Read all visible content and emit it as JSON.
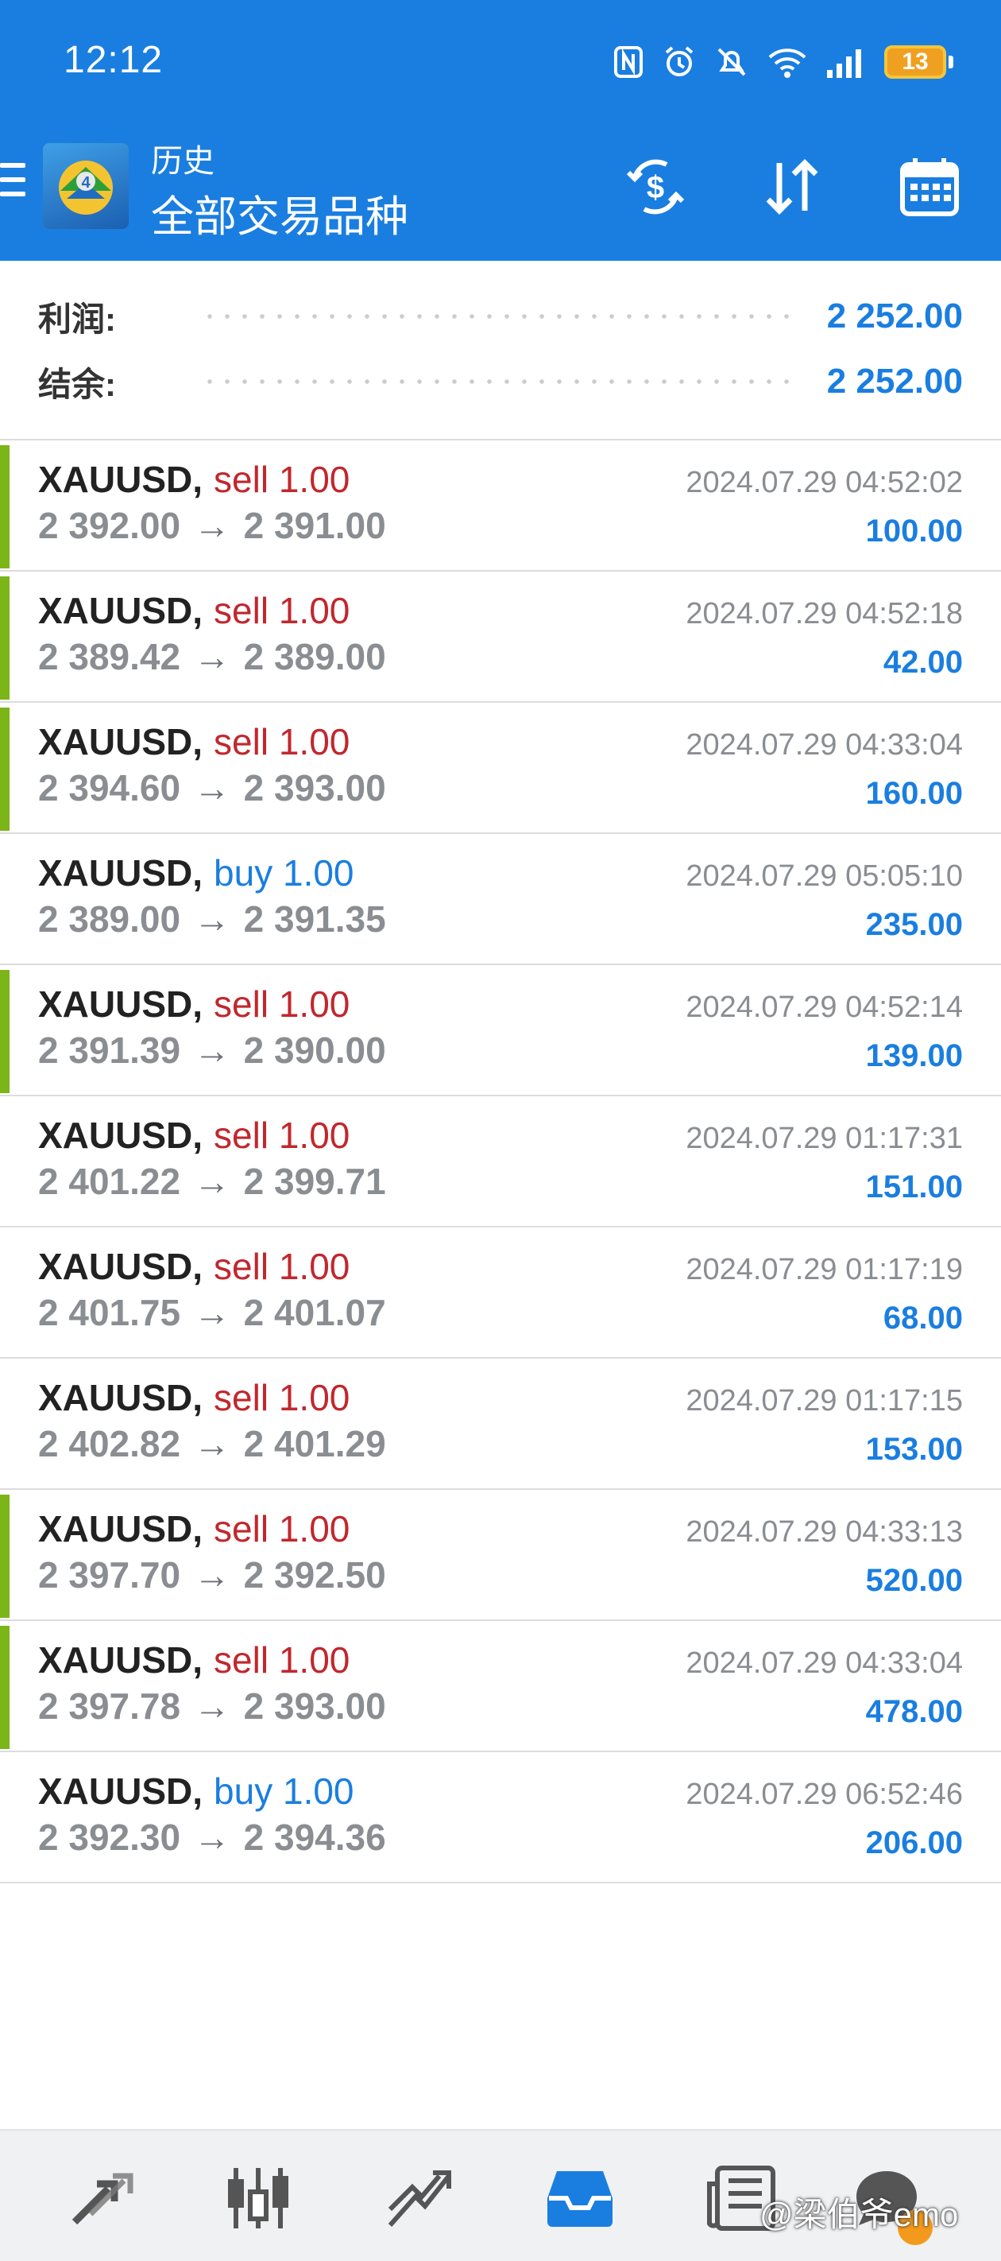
{
  "status_bar": {
    "time": "12:12",
    "battery": "13"
  },
  "header": {
    "subtitle": "历史",
    "title": "全部交易品种"
  },
  "summary": {
    "profit_label": "利润:",
    "profit_value": "2 252.00",
    "balance_label": "结余:",
    "balance_value": "2 252.00"
  },
  "trades": [
    {
      "symbol": "XAUUSD",
      "side": "sell",
      "volume": "1.00",
      "open_price": "2 392.00",
      "close_price": "2 391.00",
      "time": "2024.07.29 04:52:02",
      "profit": "100.00",
      "accent": true
    },
    {
      "symbol": "XAUUSD",
      "side": "sell",
      "volume": "1.00",
      "open_price": "2 389.42",
      "close_price": "2 389.00",
      "time": "2024.07.29 04:52:18",
      "profit": "42.00",
      "accent": true
    },
    {
      "symbol": "XAUUSD",
      "side": "sell",
      "volume": "1.00",
      "open_price": "2 394.60",
      "close_price": "2 393.00",
      "time": "2024.07.29 04:33:04",
      "profit": "160.00",
      "accent": true
    },
    {
      "symbol": "XAUUSD",
      "side": "buy",
      "volume": "1.00",
      "open_price": "2 389.00",
      "close_price": "2 391.35",
      "time": "2024.07.29 05:05:10",
      "profit": "235.00",
      "accent": false
    },
    {
      "symbol": "XAUUSD",
      "side": "sell",
      "volume": "1.00",
      "open_price": "2 391.39",
      "close_price": "2 390.00",
      "time": "2024.07.29 04:52:14",
      "profit": "139.00",
      "accent": true
    },
    {
      "symbol": "XAUUSD",
      "side": "sell",
      "volume": "1.00",
      "open_price": "2 401.22",
      "close_price": "2 399.71",
      "time": "2024.07.29 01:17:31",
      "profit": "151.00",
      "accent": false
    },
    {
      "symbol": "XAUUSD",
      "side": "sell",
      "volume": "1.00",
      "open_price": "2 401.75",
      "close_price": "2 401.07",
      "time": "2024.07.29 01:17:19",
      "profit": "68.00",
      "accent": false
    },
    {
      "symbol": "XAUUSD",
      "side": "sell",
      "volume": "1.00",
      "open_price": "2 402.82",
      "close_price": "2 401.29",
      "time": "2024.07.29 01:17:15",
      "profit": "153.00",
      "accent": false
    },
    {
      "symbol": "XAUUSD",
      "side": "sell",
      "volume": "1.00",
      "open_price": "2 397.70",
      "close_price": "2 392.50",
      "time": "2024.07.29 04:33:13",
      "profit": "520.00",
      "accent": true
    },
    {
      "symbol": "XAUUSD",
      "side": "sell",
      "volume": "1.00",
      "open_price": "2 397.78",
      "close_price": "2 393.00",
      "time": "2024.07.29 04:33:04",
      "profit": "478.00",
      "accent": true
    },
    {
      "symbol": "XAUUSD",
      "side": "buy",
      "volume": "1.00",
      "open_price": "2 392.30",
      "close_price": "2 394.36",
      "time": "2024.07.29 06:52:46",
      "profit": "206.00",
      "accent": false
    }
  ],
  "bottom_nav": [
    {
      "icon": "quotes-arrows-icon",
      "active": false
    },
    {
      "icon": "candlestick-chart-icon",
      "active": false
    },
    {
      "icon": "trade-chart-icon",
      "active": false
    },
    {
      "icon": "history-inbox-icon",
      "active": true
    },
    {
      "icon": "news-icon",
      "active": false
    },
    {
      "icon": "messages-icon",
      "active": false
    }
  ],
  "watermark": "@梁伯爷emo",
  "colors": {
    "header_bg": "#1a7ee0",
    "sell": "#c1272d",
    "buy": "#1a7ee0",
    "accent_green": "#7cb518",
    "profit": "#1a7ee0",
    "muted": "#8a8d91"
  }
}
